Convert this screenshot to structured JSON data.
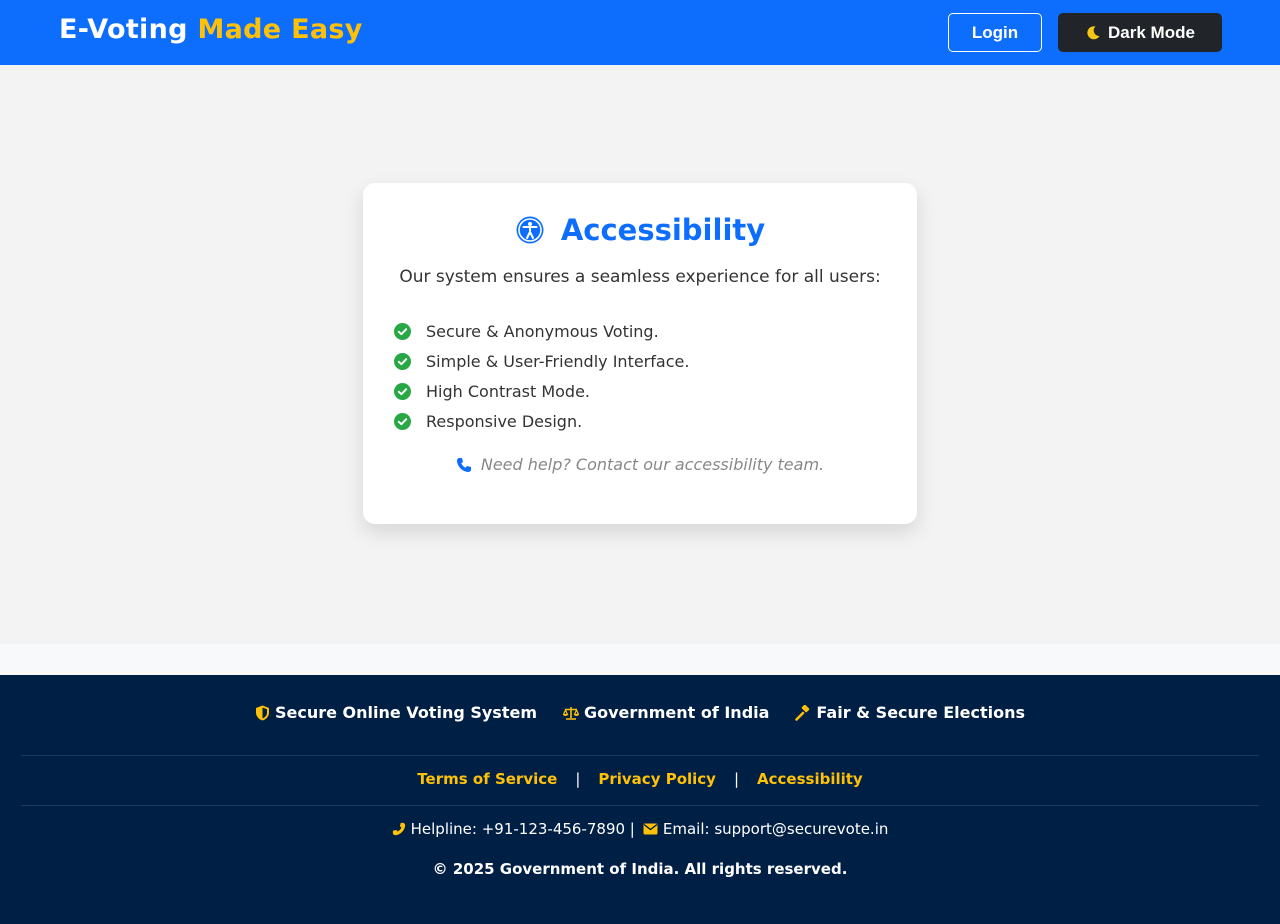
{
  "header": {
    "brand_main": "E-Voting",
    "brand_accent": "Made Easy",
    "login_label": "Login",
    "dark_mode_label": "Dark Mode",
    "dark_mode_icon": "moon-icon"
  },
  "card": {
    "title": "Accessibility",
    "title_icon": "universal-access-icon",
    "intro": "Our system ensures a seamless experience for all users:",
    "features": [
      "Secure & Anonymous Voting.",
      "Simple & User-Friendly Interface.",
      "High Contrast Mode.",
      "Responsive Design."
    ],
    "feature_icon": "check-circle-icon",
    "help_text": "Need help? Contact our accessibility team.",
    "help_icon": "phone-icon"
  },
  "footer": {
    "badges": [
      {
        "icon": "shield-icon",
        "label": "Secure Online Voting System"
      },
      {
        "icon": "scale-icon",
        "label": "Government of India"
      },
      {
        "icon": "gavel-icon",
        "label": "Fair & Secure Elections"
      }
    ],
    "links": [
      "Terms of Service",
      "Privacy Policy",
      "Accessibility"
    ],
    "link_separator": "|",
    "helpline": "Helpline: +91-123-456-7890 |",
    "email": "Email: support@securevote.in",
    "copyright": "© 2025 Government of India. All rights reserved."
  },
  "colors": {
    "primary": "#0d6efd",
    "accent": "#ffc107",
    "footer_bg": "#001f45",
    "success": "#28a745",
    "dark_button": "#212529"
  }
}
